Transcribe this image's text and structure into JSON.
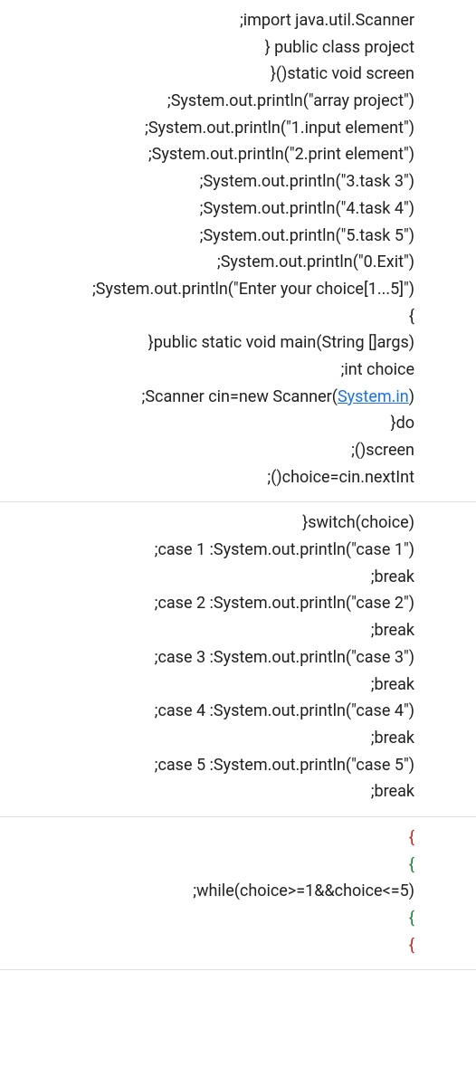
{
  "section1": {
    "lines": [
      {
        "segments": [
          {
            "text": ";import java.util.Scanner"
          }
        ]
      },
      {
        "segments": [
          {
            "text": "} public class project"
          }
        ]
      },
      {
        "segments": [
          {
            "text": "}()static void screen"
          }
        ]
      },
      {
        "segments": [
          {
            "text": ";System.out.println(\"array project\")"
          }
        ]
      },
      {
        "segments": [
          {
            "text": ";System.out.println(\"1.input element\")"
          }
        ]
      },
      {
        "segments": [
          {
            "text": ";System.out.println(\"2.print element\")"
          }
        ]
      },
      {
        "segments": [
          {
            "text": ";System.out.println(\"3.task 3\")"
          }
        ]
      },
      {
        "segments": [
          {
            "text": ";System.out.println(\"4.task 4\")"
          }
        ]
      },
      {
        "segments": [
          {
            "text": ";System.out.println(\"5.task 5\")"
          }
        ]
      },
      {
        "segments": [
          {
            "text": ";System.out.println(\"0.Exit\")"
          }
        ]
      },
      {
        "segments": [
          {
            "text": ";System.out.println(\"Enter your choice[1...5]\")"
          }
        ]
      },
      {
        "segments": [
          {
            "text": "{"
          }
        ]
      },
      {
        "segments": [
          {
            "text": "}public static void main(String []args)"
          }
        ]
      },
      {
        "segments": [
          {
            "text": ";int choice"
          }
        ]
      },
      {
        "segments": [
          {
            "text": ";Scanner cin=new Scanner("
          },
          {
            "text": "System.in",
            "link": true
          },
          {
            "text": ")"
          }
        ]
      },
      {
        "segments": [
          {
            "text": "}do"
          }
        ]
      },
      {
        "segments": [
          {
            "text": ";()screen"
          }
        ]
      },
      {
        "segments": [
          {
            "text": ";()choice=cin.nextInt"
          }
        ]
      }
    ]
  },
  "section2": {
    "lines": [
      {
        "segments": [
          {
            "text": "}switch(choice)"
          }
        ]
      },
      {
        "segments": [
          {
            "text": ";case 1 :System.out.println(\"case 1\")"
          }
        ]
      },
      {
        "segments": [
          {
            "text": ";break"
          }
        ]
      },
      {
        "segments": [
          {
            "text": ";case 2 :System.out.println(\"case 2\")"
          }
        ]
      },
      {
        "segments": [
          {
            "text": ";break"
          }
        ]
      },
      {
        "segments": [
          {
            "text": ";case 3 :System.out.println(\"case 3\")"
          }
        ]
      },
      {
        "segments": [
          {
            "text": ";break"
          }
        ]
      },
      {
        "segments": [
          {
            "text": ";case 4 :System.out.println(\"case 4\")"
          }
        ]
      },
      {
        "segments": [
          {
            "text": ";break"
          }
        ]
      },
      {
        "segments": [
          {
            "text": ";case 5 :System.out.println(\"case 5\")"
          }
        ]
      },
      {
        "segments": [
          {
            "text": ";break"
          }
        ]
      }
    ]
  },
  "section3": {
    "lines": [
      {
        "segments": [
          {
            "text": "{",
            "red": true
          }
        ]
      },
      {
        "segments": [
          {
            "text": "{",
            "green": true
          }
        ]
      },
      {
        "segments": [
          {
            "text": ";while(choice>=1&&choice<=5)"
          }
        ]
      },
      {
        "segments": [
          {
            "text": "{",
            "green": true
          }
        ]
      },
      {
        "segments": [
          {
            "text": "{",
            "red": true
          }
        ]
      }
    ]
  }
}
